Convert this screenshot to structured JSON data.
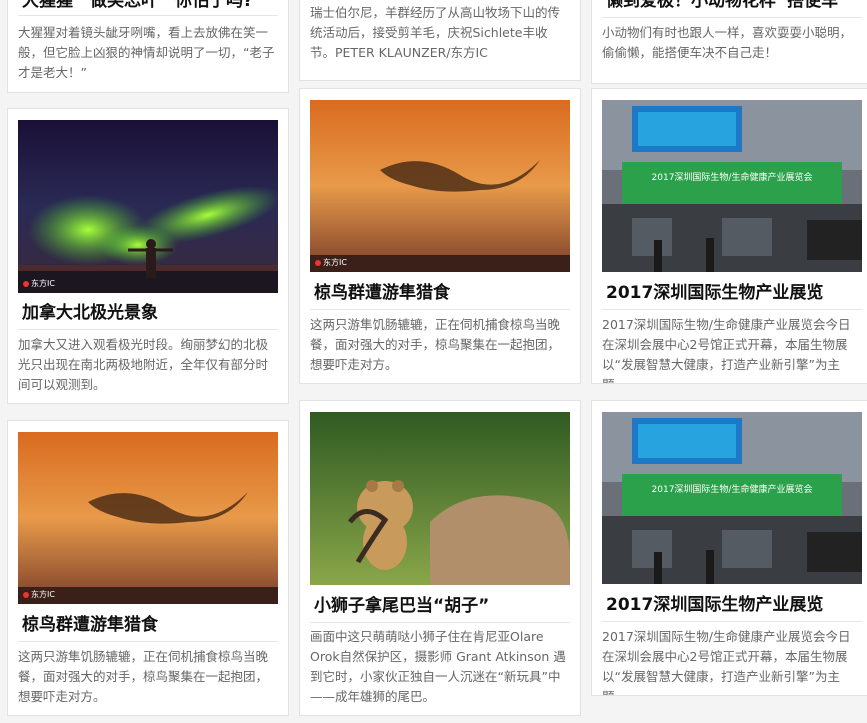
{
  "cards": {
    "c1": {
      "title": "大猩猩　做笑忘叶　你怕了吗?",
      "desc": "大猩猩对着镜头龇牙咧嘴，看上去放佛在笑一般，但它脸上凶狠的神情却说明了一切，“老子才是老大！”"
    },
    "c2": {
      "title": "加拿大北极光景象",
      "desc": "加拿大又进入观看极光时段。绚丽梦幻的北极光只出现在南北两极地附近，全年仅有部分时间可以观测到。",
      "watermark": "东方IC"
    },
    "c3": {
      "title": "椋鸟群遭游隼猎食",
      "desc": "这两只游隼饥肠辘辘，正在伺机捕食椋鸟当晚餐，面对强大的对手，椋鸟聚集在一起抱团，想要吓走对方。",
      "watermark": "东方IC"
    },
    "c4": {
      "desc": "瑞士伯尔尼，羊群经历了从高山牧场下山的传统活动后，接受剪羊毛，庆祝Sichlete丰收节。PETER KLAUNZER/东方IC"
    },
    "c5": {
      "title": "椋鸟群遭游隼猎食",
      "desc": "这两只游隼饥肠辘辘，正在伺机捕食椋鸟当晚餐，面对强大的对手，椋鸟聚集在一起抱团，想要吓走对方。",
      "watermark": "东方IC"
    },
    "c6": {
      "title": "小狮子拿尾巴当“胡子”",
      "desc": "画面中这只萌萌哒小狮子住在肯尼亚Olare Orok自然保护区，摄影师 Grant Atkinson 遇到它时，小家伙正独自一人沉迷在“新玩具”中——成年雄狮的尾巴。"
    },
    "c7": {
      "title": "懒到爱极！小动物花样“搭便车”",
      "desc": "小动物们有时也跟人一样，喜欢耍耍小聪明，偷偷懒，能搭便车决不自己走！"
    },
    "c8": {
      "title": "2017深圳国际生物产业展览",
      "desc": "2017深圳国际生物/生命健康产业展览会今日在深圳会展中心2号馆正式开幕，本届生物展以“发展智慧大健康，打造产业新引擎”为主题。",
      "banner": "2017深圳国际生物/生命健康产业展览会"
    },
    "c9": {
      "title": "2017深圳国际生物产业展览",
      "desc": "2017深圳国际生物/生命健康产业展览会今日在深圳会展中心2号馆正式开幕，本届生物展以“发展智慧大健康，打造产业新引擎”为主题。",
      "banner": "2017深圳国际生物/生命健康产业展览会"
    }
  }
}
